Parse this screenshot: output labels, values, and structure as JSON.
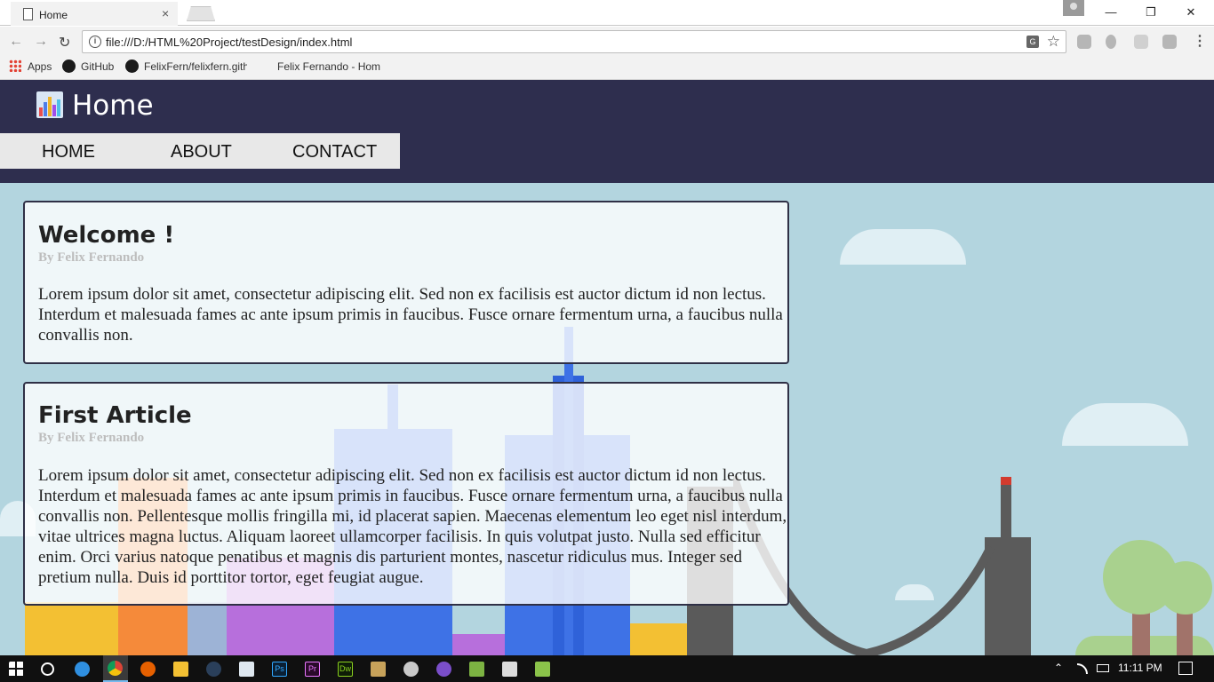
{
  "browser": {
    "tab_title": "Home",
    "tab_close": "×",
    "url": "file:///D:/HTML%20Project/testDesign/index.html",
    "info_glyph": "i",
    "translate_glyph": "G",
    "star_glyph": "☆",
    "menu_glyph": "⋮",
    "back_glyph": "←",
    "forward_glyph": "→",
    "reload_glyph": "↻",
    "minimize_glyph": "—",
    "restore_glyph": "❐",
    "close_glyph": "✕",
    "bookmarks": [
      {
        "label": "Apps"
      },
      {
        "label": "GitHub"
      },
      {
        "label": "FelixFern/felixfern.gith"
      },
      {
        "label": "Felix Fernando - Hom"
      }
    ]
  },
  "site": {
    "title": "Home",
    "nav": [
      "HOME",
      "ABOUT",
      "CONTACT"
    ],
    "header_color": "#2e2e4e",
    "background_color": "#b3d5df"
  },
  "articles": [
    {
      "title": "Welcome !",
      "author": "By Felix Fernando",
      "body": "Lorem ipsum dolor sit amet, consectetur adipiscing elit. Sed non ex facilisis est auctor dictum id non lectus. Interdum et malesuada fames ac ante ipsum primis in faucibus. Fusce ornare fermentum urna, a faucibus nulla convallis non."
    },
    {
      "title": "First Article",
      "author": "By Felix Fernando",
      "body": "Lorem ipsum dolor sit amet, consectetur adipiscing elit. Sed non ex facilisis est auctor dictum id non lectus. Interdum et malesuada fames ac ante ipsum primis in faucibus. Fusce ornare fermentum urna, a faucibus nulla convallis non. Pellentesque mollis fringilla mi, id placerat sapien. Maecenas elementum leo eget nisl interdum, vitae ultrices magna luctus. Aliquam laoreet ullamcorper facilisis. In quis volutpat justo. Nulla sed efficitur enim. Orci varius natoque penatibus et magnis dis parturient montes, nascetur ridiculus mus. Integer sed pretium nulla. Duis id porttitor tortor, eget feugiat augue."
    }
  ],
  "taskbar": {
    "clock": "11:11 PM",
    "apps": [
      "start-icon",
      "cortana-icon",
      "edge-icon",
      "chrome-icon",
      "firefox-icon",
      "file-explorer-icon",
      "steam-icon",
      "notepad-icon",
      "photoshop-icon",
      "premiere-icon",
      "dreamweaver-icon",
      "app-icon",
      "app-icon",
      "app-icon",
      "app-icon",
      "app-icon",
      "app-icon"
    ],
    "ps_label": "Ps",
    "pr_label": "Pr",
    "dw_label": "Dw"
  }
}
